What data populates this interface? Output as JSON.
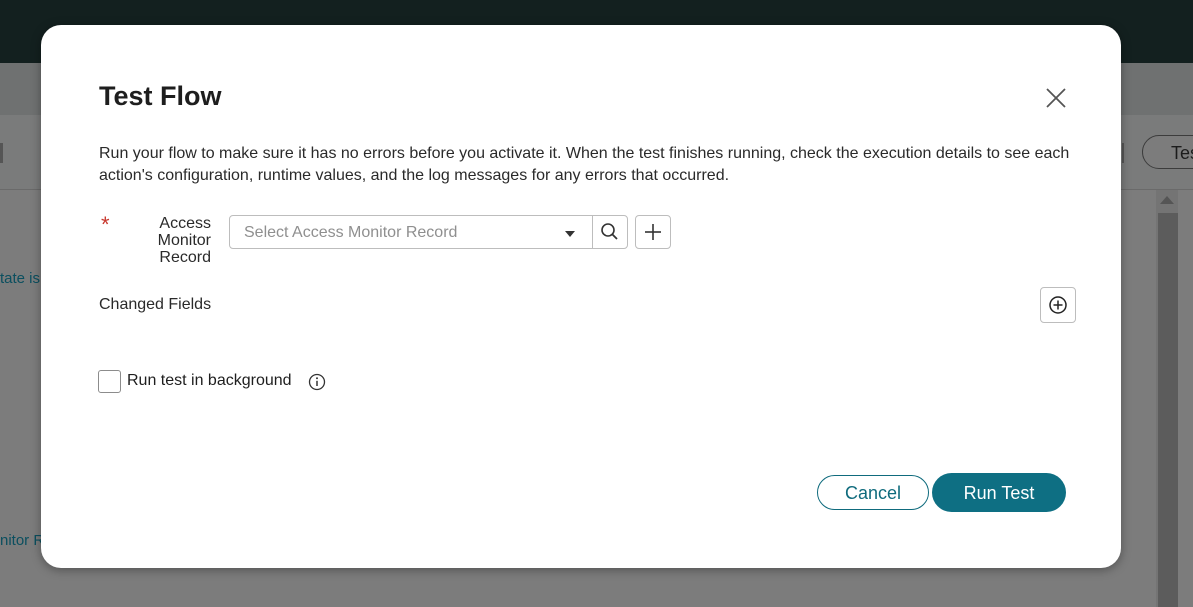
{
  "background": {
    "tab_button_label": "Tes",
    "link_1": "tate is",
    "link_2": "nitor R"
  },
  "modal": {
    "title": "Test Flow",
    "description": "Run your flow to make sure it has no errors before you activate it. When the test finishes running, check the execution details to see each action's configuration, runtime values, and the log messages for any errors that occurred.",
    "record_field": {
      "required_marker": "*",
      "label": "Access Monitor Record",
      "placeholder": "Select Access Monitor Record"
    },
    "changed_fields_label": "Changed Fields",
    "background_checkbox": {
      "label": "Run test in background",
      "checked": false
    },
    "buttons": {
      "cancel": "Cancel",
      "run": "Run Test"
    }
  },
  "icons": [
    "close-icon",
    "chevron-down-icon",
    "search-icon",
    "plus-icon",
    "plus-circle-icon",
    "info-icon"
  ],
  "colors": {
    "primary": "#0e6f83",
    "required": "#c8372d",
    "topbar": "#13201f"
  }
}
